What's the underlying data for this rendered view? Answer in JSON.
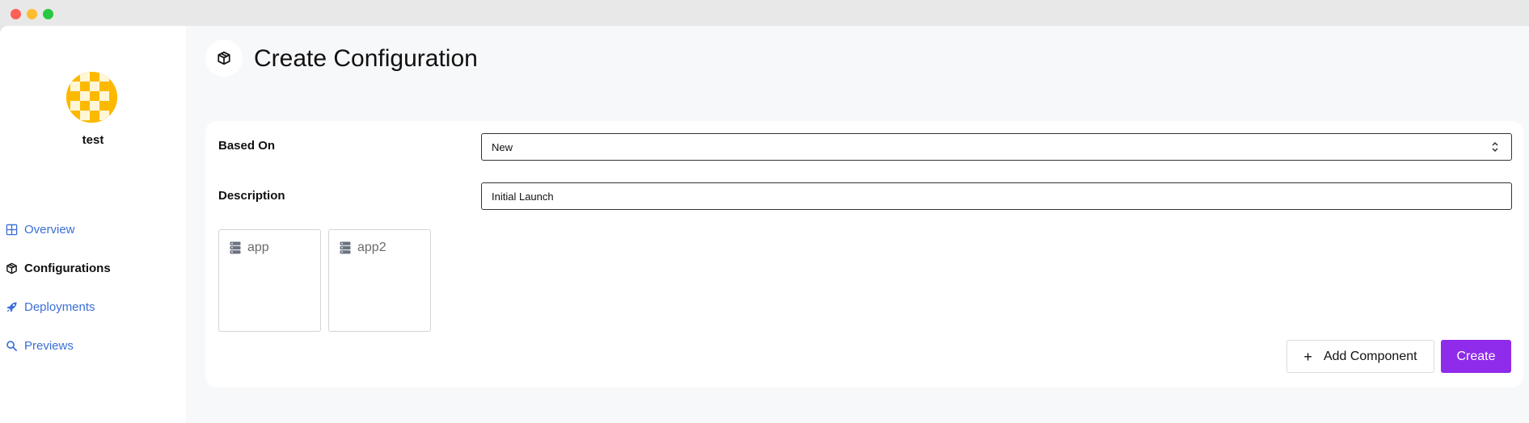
{
  "window": {
    "controls": [
      "close",
      "minimize",
      "maximize"
    ]
  },
  "sidebar": {
    "team_name": "test",
    "items": [
      {
        "label": "Overview",
        "icon": "grid-icon",
        "active": false
      },
      {
        "label": "Configurations",
        "icon": "cube-icon",
        "active": true
      },
      {
        "label": "Deployments",
        "icon": "rocket-icon",
        "active": false
      },
      {
        "label": "Previews",
        "icon": "search-icon",
        "active": false
      }
    ]
  },
  "page": {
    "title": "Create Configuration",
    "icon": "cube-icon"
  },
  "form": {
    "based_on_label": "Based On",
    "based_on_value": "New",
    "description_label": "Description",
    "description_value": "Initial Launch"
  },
  "components": [
    {
      "name": "app",
      "icon": "server-icon"
    },
    {
      "name": "app2",
      "icon": "server-icon"
    }
  ],
  "actions": {
    "add_component_label": "Add Component",
    "create_label": "Create"
  },
  "colors": {
    "accent": "#8f2bea",
    "link": "#3b6fd6",
    "avatar": "#fcb900"
  }
}
